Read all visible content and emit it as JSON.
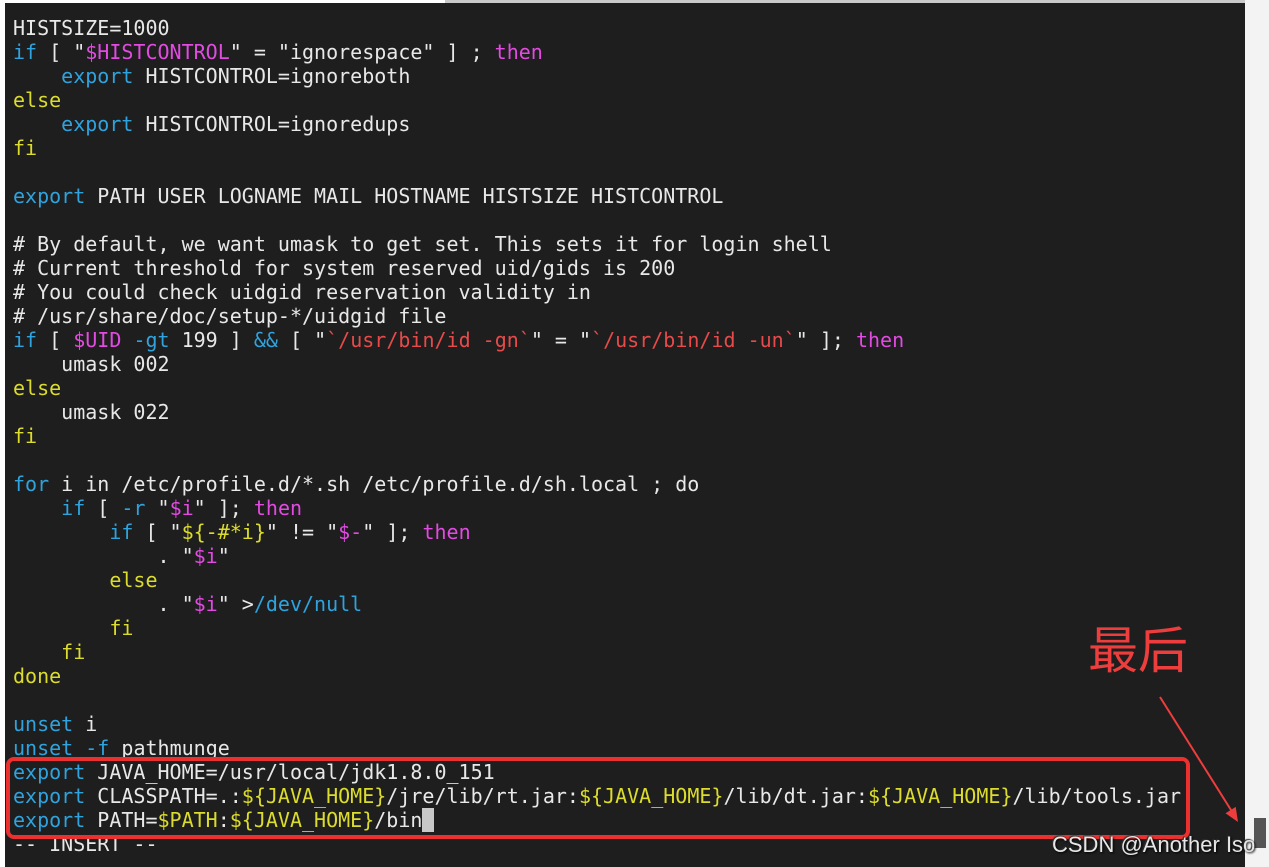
{
  "editor": {
    "lines": [
      [
        {
          "text": "HISTSIZE=1000",
          "style": "plain"
        }
      ],
      [
        {
          "text": "if",
          "style": "keyword"
        },
        {
          "text": " [ \"",
          "style": "plain"
        },
        {
          "text": "$HISTCONTROL",
          "style": "var"
        },
        {
          "text": "\" = \"ignorespace\" ] ; ",
          "style": "plain"
        },
        {
          "text": "then",
          "style": "then"
        }
      ],
      [
        {
          "text": "    ",
          "style": "plain"
        },
        {
          "text": "export",
          "style": "keyword"
        },
        {
          "text": " HISTCONTROL=ignoreboth",
          "style": "plain"
        }
      ],
      [
        {
          "text": "else",
          "style": "block"
        }
      ],
      [
        {
          "text": "    ",
          "style": "plain"
        },
        {
          "text": "export",
          "style": "keyword"
        },
        {
          "text": " HISTCONTROL=ignoredups",
          "style": "plain"
        }
      ],
      [
        {
          "text": "fi",
          "style": "block"
        }
      ],
      [],
      [
        {
          "text": "export",
          "style": "keyword"
        },
        {
          "text": " PATH USER LOGNAME MAIL HOSTNAME HISTSIZE HISTCONTROL",
          "style": "plain"
        }
      ],
      [],
      [
        {
          "text": "# By default, we want umask to get set. This sets it for login shell",
          "style": "plain"
        }
      ],
      [
        {
          "text": "# Current threshold for system reserved uid/gids is 200",
          "style": "plain"
        }
      ],
      [
        {
          "text": "# You could check uidgid reservation validity in",
          "style": "plain"
        }
      ],
      [
        {
          "text": "# /usr/share/doc/setup-*/uidgid file",
          "style": "plain"
        }
      ],
      [
        {
          "text": "if",
          "style": "keyword"
        },
        {
          "text": " [ ",
          "style": "plain"
        },
        {
          "text": "$UID",
          "style": "var"
        },
        {
          "text": " ",
          "style": "plain"
        },
        {
          "text": "-gt",
          "style": "keyword"
        },
        {
          "text": " 199 ] ",
          "style": "plain"
        },
        {
          "text": "&&",
          "style": "keyword"
        },
        {
          "text": " [ \"",
          "style": "plain"
        },
        {
          "text": "`/usr/bin/id -gn`",
          "style": "cmdsub"
        },
        {
          "text": "\" = \"",
          "style": "plain"
        },
        {
          "text": "`/usr/bin/id -un`",
          "style": "cmdsub"
        },
        {
          "text": "\" ]; ",
          "style": "plain"
        },
        {
          "text": "then",
          "style": "then"
        }
      ],
      [
        {
          "text": "    umask 002",
          "style": "plain"
        }
      ],
      [
        {
          "text": "else",
          "style": "block"
        }
      ],
      [
        {
          "text": "    umask 022",
          "style": "plain"
        }
      ],
      [
        {
          "text": "fi",
          "style": "block"
        }
      ],
      [],
      [
        {
          "text": "for",
          "style": "keyword"
        },
        {
          "text": " i in /etc/profile.d/*.sh /etc/profile.d/sh.local ; do",
          "style": "plain"
        }
      ],
      [
        {
          "text": "    ",
          "style": "plain"
        },
        {
          "text": "if",
          "style": "keyword"
        },
        {
          "text": " [ ",
          "style": "plain"
        },
        {
          "text": "-r",
          "style": "keyword"
        },
        {
          "text": " \"",
          "style": "plain"
        },
        {
          "text": "$i",
          "style": "var"
        },
        {
          "text": "\" ]; ",
          "style": "plain"
        },
        {
          "text": "then",
          "style": "then"
        }
      ],
      [
        {
          "text": "        ",
          "style": "plain"
        },
        {
          "text": "if",
          "style": "keyword"
        },
        {
          "text": " [ \"",
          "style": "plain"
        },
        {
          "text": "${-#*i}",
          "style": "expansion"
        },
        {
          "text": "\" != \"",
          "style": "plain"
        },
        {
          "text": "$-",
          "style": "var"
        },
        {
          "text": "\" ]; ",
          "style": "plain"
        },
        {
          "text": "then",
          "style": "then"
        }
      ],
      [
        {
          "text": "            . \"",
          "style": "plain"
        },
        {
          "text": "$i",
          "style": "var"
        },
        {
          "text": "\"",
          "style": "plain"
        }
      ],
      [
        {
          "text": "        ",
          "style": "plain"
        },
        {
          "text": "else",
          "style": "block"
        }
      ],
      [
        {
          "text": "            . \"",
          "style": "plain"
        },
        {
          "text": "$i",
          "style": "var"
        },
        {
          "text": "\" >",
          "style": "plain"
        },
        {
          "text": "/dev/null",
          "style": "keyword"
        }
      ],
      [
        {
          "text": "        ",
          "style": "plain"
        },
        {
          "text": "fi",
          "style": "block"
        }
      ],
      [
        {
          "text": "    ",
          "style": "plain"
        },
        {
          "text": "fi",
          "style": "block"
        }
      ],
      [
        {
          "text": "done",
          "style": "block"
        }
      ],
      [],
      [
        {
          "text": "unset",
          "style": "keyword"
        },
        {
          "text": " i",
          "style": "plain"
        }
      ],
      [
        {
          "text": "unset",
          "style": "keyword"
        },
        {
          "text": " ",
          "style": "plain"
        },
        {
          "text": "-f",
          "style": "keyword"
        },
        {
          "text": " pathmunge",
          "style": "plain"
        }
      ],
      [
        {
          "text": "export",
          "style": "keyword"
        },
        {
          "text": " JAVA_HOME=/usr/local/jdk1.8.0_151",
          "style": "plain"
        }
      ],
      [
        {
          "text": "export",
          "style": "keyword"
        },
        {
          "text": " CLASSPATH=.:",
          "style": "plain"
        },
        {
          "text": "${JAVA_HOME}",
          "style": "expansion"
        },
        {
          "text": "/jre/lib/rt.jar:",
          "style": "plain"
        },
        {
          "text": "${JAVA_HOME}",
          "style": "expansion"
        },
        {
          "text": "/lib/dt.jar:",
          "style": "plain"
        },
        {
          "text": "${JAVA_HOME}",
          "style": "expansion"
        },
        {
          "text": "/lib/tools.jar",
          "style": "plain"
        }
      ],
      [
        {
          "text": "export",
          "style": "keyword"
        },
        {
          "text": " PATH=",
          "style": "plain"
        },
        {
          "text": "$PATH",
          "style": "expansion"
        },
        {
          "text": ":",
          "style": "plain"
        },
        {
          "text": "${JAVA_HOME}",
          "style": "expansion"
        },
        {
          "text": "/bin",
          "style": "plain"
        },
        {
          "text": " ",
          "style": "cursor"
        }
      ]
    ],
    "mode": "-- INSERT --"
  },
  "annotation": {
    "label": "最后"
  },
  "watermark": "CSDN @Another Iso",
  "colors": {
    "background": "#1e1e1e",
    "plain": "#e8e8e8",
    "keyword": "#2ea3dd",
    "then": "#e24ae2",
    "block": "#dcdc2c",
    "var": "#e24ae2",
    "expansion": "#dcdc2c",
    "cmdsub": "#e84a4a",
    "cursor": "#c8c8c8",
    "annotation": "#ec3030"
  }
}
